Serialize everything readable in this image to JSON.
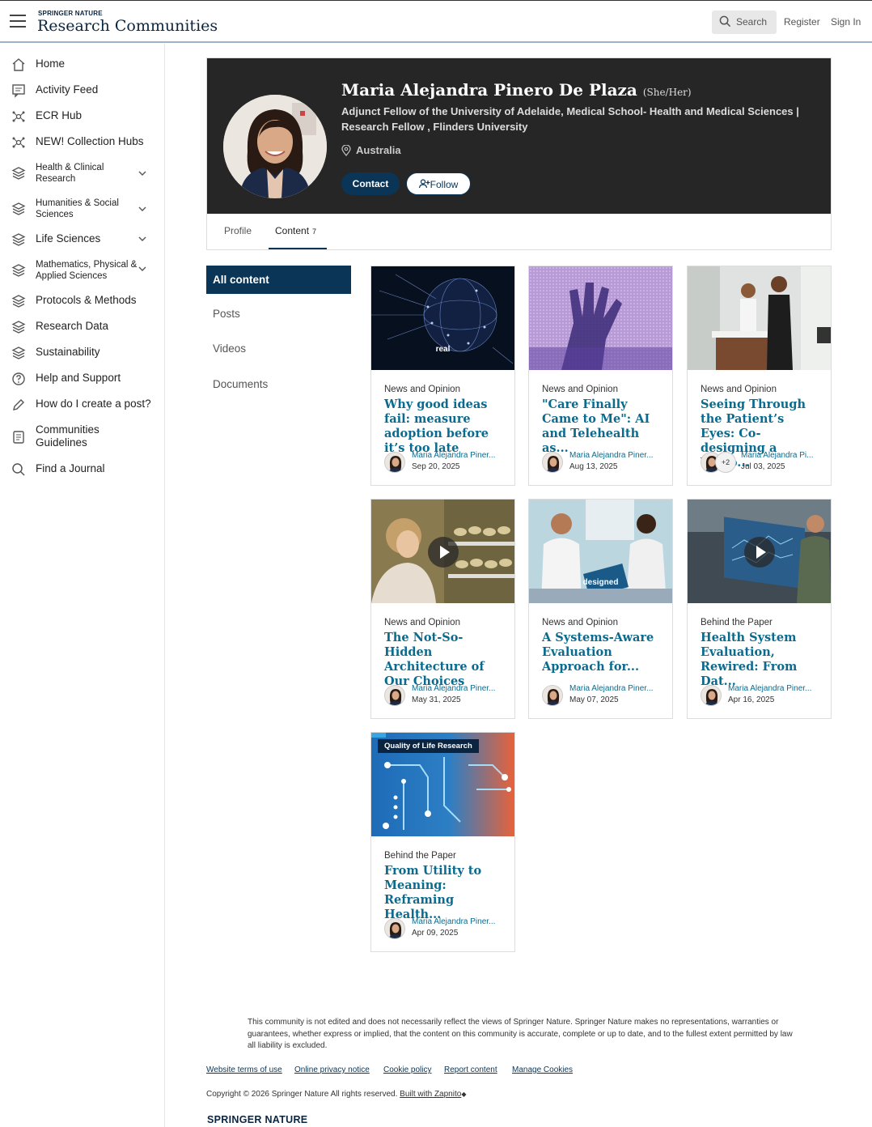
{
  "header": {
    "brand_small": "SPRINGER NATURE",
    "brand_main": "Research Communities",
    "search_label": "Search",
    "register_label": "Register",
    "signin_label": "Sign In"
  },
  "sidebar": {
    "items": [
      {
        "label": "Home",
        "icon": "home-icon"
      },
      {
        "label": "Activity Feed",
        "icon": "feed-icon"
      },
      {
        "label": "ECR Hub",
        "icon": "network-icon"
      },
      {
        "label": "NEW! Collection Hubs",
        "icon": "network-icon"
      },
      {
        "label": "Health & Clinical Research",
        "icon": "layers-icon",
        "expandable": true
      },
      {
        "label": "Humanities & Social Sciences",
        "icon": "layers-icon",
        "expandable": true
      },
      {
        "label": "Life Sciences",
        "icon": "layers-icon",
        "expandable": true
      },
      {
        "label": "Mathematics, Physical & Applied Sciences",
        "icon": "layers-icon",
        "expandable": true
      },
      {
        "label": "Protocols & Methods",
        "icon": "layers-icon"
      },
      {
        "label": "Research Data",
        "icon": "layers-icon"
      },
      {
        "label": "Sustainability",
        "icon": "layers-icon"
      },
      {
        "label": "Help and Support",
        "icon": "help-icon"
      },
      {
        "label": "How do I create a post?",
        "icon": "pencil-icon"
      },
      {
        "label": "Communities Guidelines",
        "icon": "document-icon"
      },
      {
        "label": "Find a Journal",
        "icon": "search-icon"
      }
    ]
  },
  "profile": {
    "name": "Maria Alejandra Pinero De Plaza",
    "pronouns": "(She/Her)",
    "affiliation": "Adjunct Fellow of the University of Adelaide, Medical School- Health and Medical Sciences | Research Fellow , Flinders University",
    "location": "Australia",
    "contact_label": "Contact",
    "follow_label": "Follow",
    "tabs": [
      {
        "label": "Profile"
      },
      {
        "label": "Content",
        "count": "7"
      }
    ]
  },
  "filters": {
    "active": "All content",
    "items": [
      "Posts",
      "Videos",
      "Documents"
    ]
  },
  "cards": [
    {
      "category": "News and Opinion",
      "title": "Why good ideas fail: measure adoption before it’s too late",
      "author": "Maria Alejandra Piner...",
      "date": "Sep 20, 2025",
      "caption": "real"
    },
    {
      "category": "News and Opinion",
      "title": "\"Care Finally Came to Me\": AI and Telehealth as...",
      "author": "Maria Alejandra Piner...",
      "date": "Aug 13, 2025"
    },
    {
      "category": "News and Opinion",
      "title": "Seeing Through the Patient’s Eyes: Co-designing a Video...",
      "author": "Maria Alejandra Pi...",
      "date": "Jul 03, 2025",
      "extra_authors": "+2"
    },
    {
      "category": "News and Opinion",
      "title": "The Not-So-Hidden Architecture of Our Choices",
      "author": "Maria Alejandra Piner...",
      "date": "May 31, 2025"
    },
    {
      "category": "News and Opinion",
      "title": "A Systems-Aware Evaluation Approach for...",
      "author": "Maria Alejandra Piner...",
      "date": "May 07, 2025",
      "caption": "designed"
    },
    {
      "category": "Behind the Paper",
      "title": "Health System Evaluation, Rewired: From Dat...",
      "author": "Maria Alejandra Piner...",
      "date": "Apr 16, 2025"
    },
    {
      "category": "Behind the Paper",
      "title": "From Utility to Meaning: Reframing Health...",
      "author": "Maria Alejandra Piner...",
      "date": "Apr 09, 2025",
      "badge": "Quality of Life Research"
    }
  ],
  "footer": {
    "disclaimer": "This community is not edited and does not necessarily reflect the views of Springer Nature. Springer Nature makes no representations, warranties or guarantees, whether express or implied, that the content on this community is accurate, complete or up to date, and to the fullest extent permitted by law all liability is excluded.",
    "links": [
      "Website terms of use",
      "Online privacy notice",
      "Cookie policy",
      "Report content",
      "Manage Cookies"
    ],
    "copyright": "Copyright © 2026 Springer Nature All rights reserved.",
    "built_with": "Built with Zapnito",
    "logo": "SPRINGER NATURE"
  },
  "colors": {
    "navy": "#0b3556",
    "link": "#0b6b8f",
    "banner": "#262626"
  }
}
